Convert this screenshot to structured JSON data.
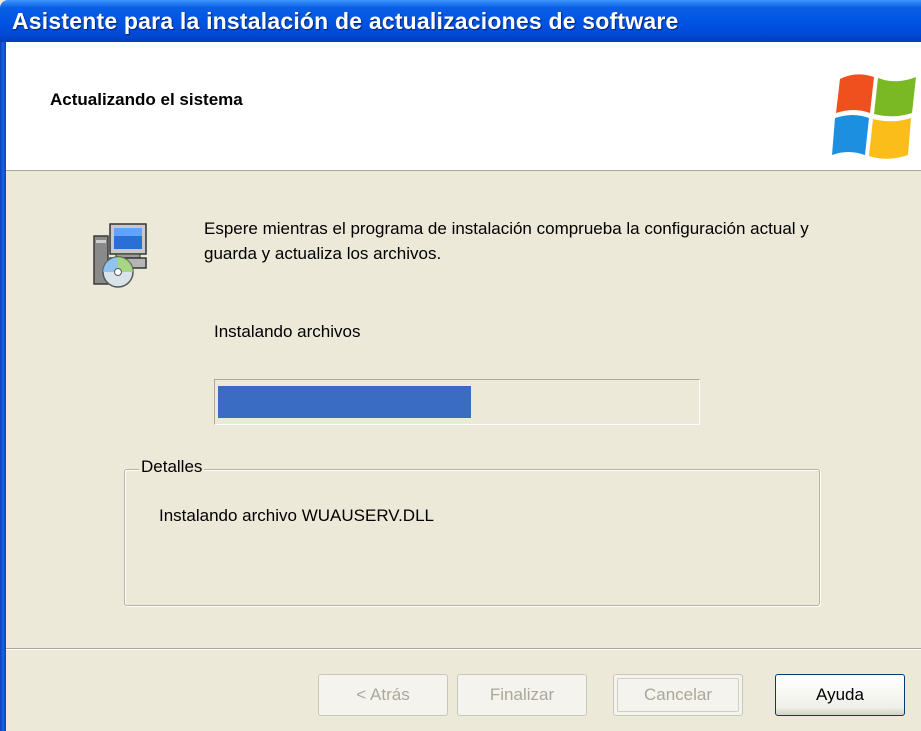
{
  "window": {
    "title": "Asistente para la instalación de actualizaciones de software"
  },
  "header": {
    "title": "Actualizando el sistema"
  },
  "main": {
    "message": "Espere mientras el programa de instalación comprueba la configuración actual y guarda y actualiza los archivos.",
    "status_label": "Instalando archivos",
    "progress_fraction": 0.53
  },
  "details": {
    "legend": "Detalles",
    "text": "Instalando archivo WUAUSERV.DLL"
  },
  "buttons": {
    "back": "< Atrás",
    "finish": "Finalizar",
    "cancel": "Cancelar",
    "help": "Ayuda"
  },
  "icons": {
    "header_logo": "windows-flag-icon",
    "setup": "setup-computer-cd-icon"
  },
  "colors": {
    "title_bar": "#0054e3",
    "progress_fill": "#3a6cc4",
    "dialog_bg": "#ece9d8"
  }
}
